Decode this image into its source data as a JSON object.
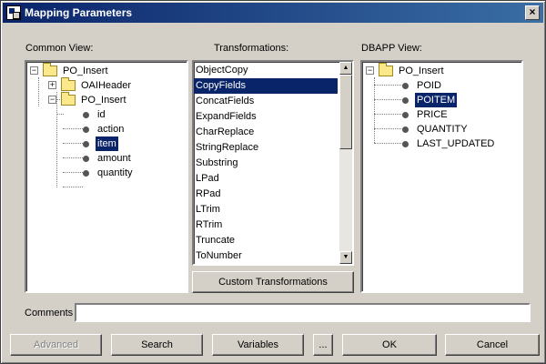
{
  "window": {
    "title": "Mapping Parameters",
    "close_icon": "close-icon"
  },
  "common_view": {
    "label": "Common View:",
    "tree": {
      "root": "PO_Insert",
      "oaiheader": "OAIHeader",
      "po_insert_child": "PO_Insert",
      "fields": [
        "id",
        "action",
        "item",
        "amount",
        "quantity"
      ],
      "selected": "item"
    }
  },
  "transformations": {
    "label": "Transformations:",
    "items": [
      "ObjectCopy",
      "CopyFields",
      "ConcatFields",
      "ExpandFields",
      "CharReplace",
      "StringReplace",
      "Substring",
      "LPad",
      "RPad",
      "LTrim",
      "RTrim",
      "Truncate",
      "ToNumber"
    ],
    "selected": "CopyFields",
    "custom_button": "Custom Transformations"
  },
  "dbapp_view": {
    "label": "DBAPP View:",
    "tree": {
      "root": "PO_Insert",
      "fields": [
        "POID",
        "POITEM",
        "PRICE",
        "QUANTITY",
        "LAST_UPDATED"
      ],
      "selected": "POITEM"
    }
  },
  "comments": {
    "label": "Comments",
    "value": ""
  },
  "buttons": {
    "advanced": "Advanced",
    "search": "Search",
    "variables": "Variables",
    "ellipsis": "...",
    "ok": "OK",
    "cancel": "Cancel"
  },
  "colors": {
    "titlebar_start": "#0a246a",
    "titlebar_end": "#3a6ea5",
    "selection": "#0a246a",
    "dialog_bg": "#d4d0c8"
  }
}
